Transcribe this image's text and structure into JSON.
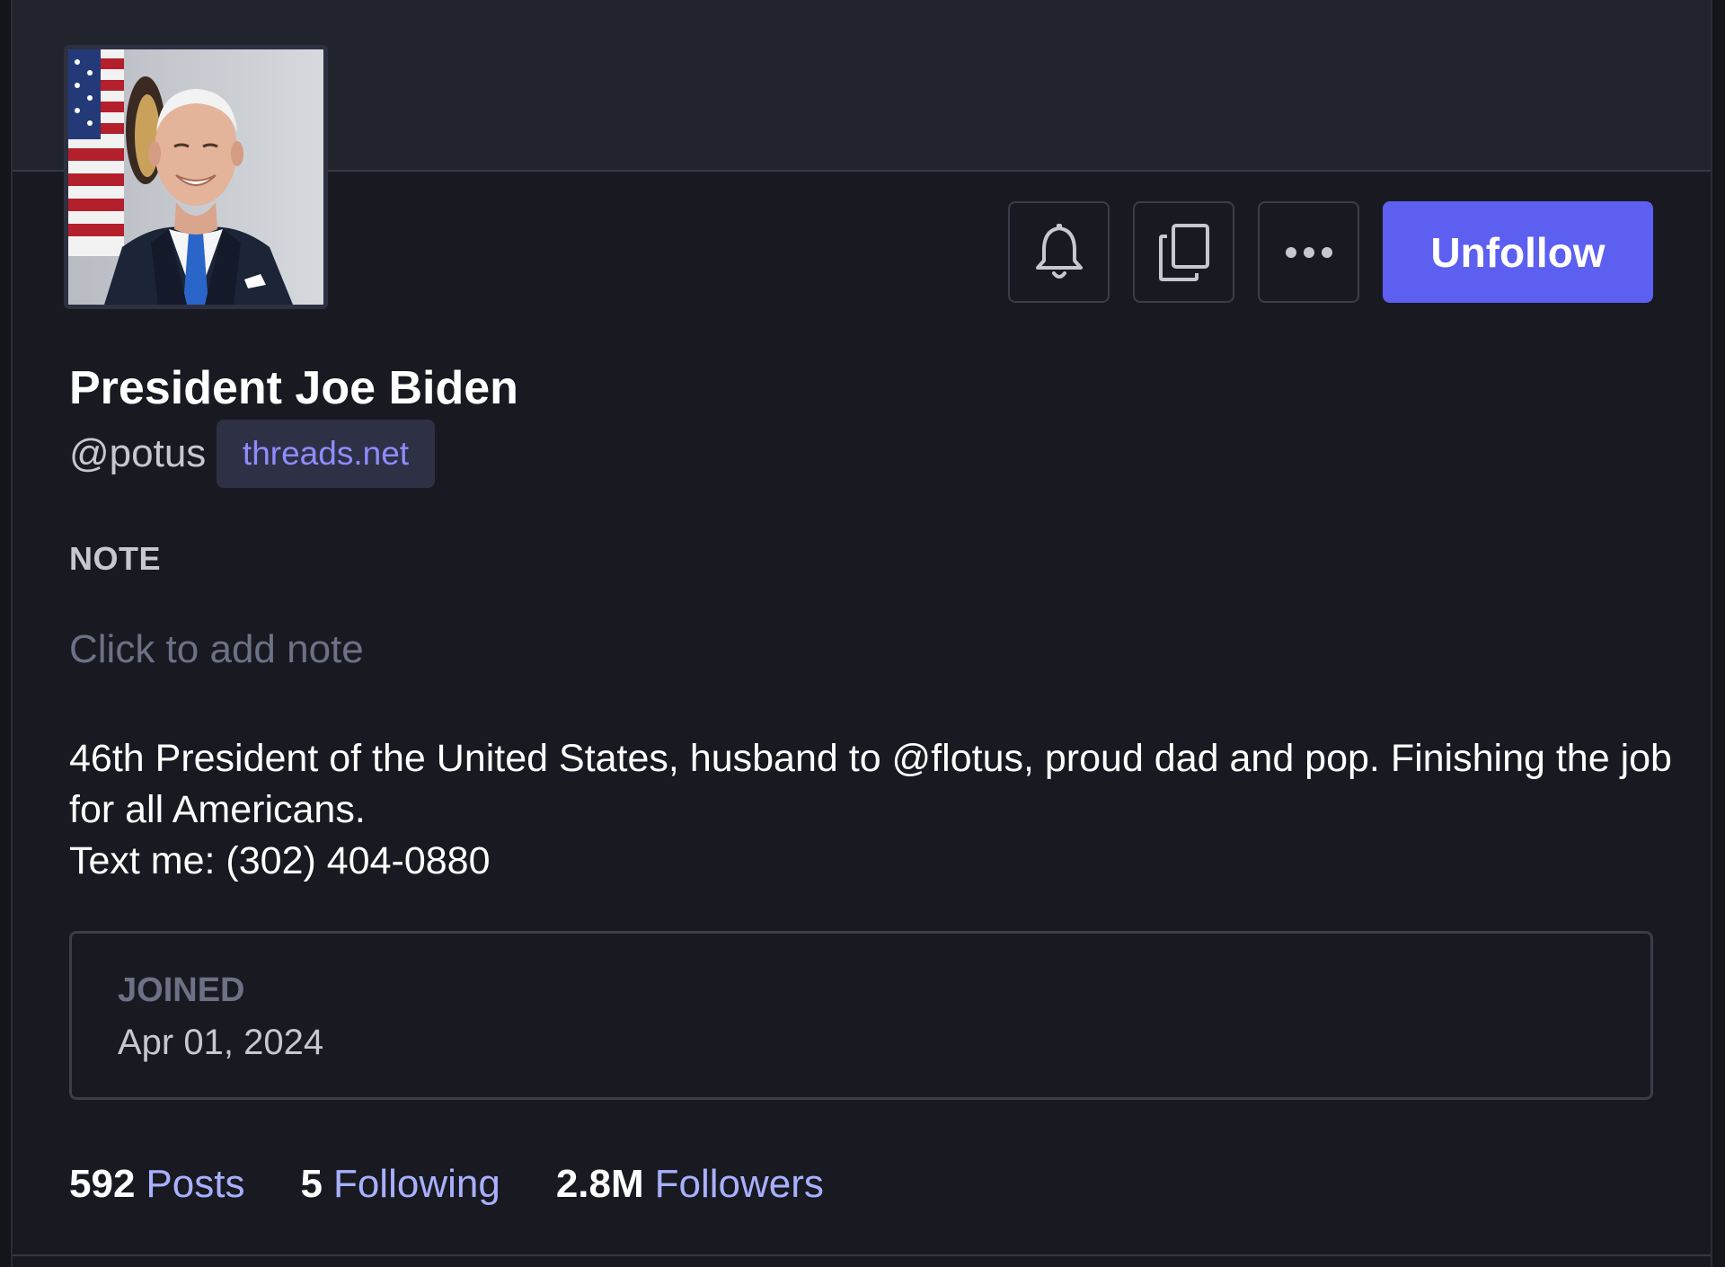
{
  "profile": {
    "display_name": "President Joe Biden",
    "handle": "@potus",
    "domain": "threads.net",
    "avatar_alt": "Portrait of President Joe Biden"
  },
  "actions": {
    "notify_icon": "bell-icon",
    "copy_icon": "copy-icon",
    "more_icon": "more-horizontal-icon",
    "unfollow_label": "Unfollow"
  },
  "note": {
    "label": "NOTE",
    "placeholder": "Click to add note"
  },
  "bio": {
    "line1": "46th President of the United States, husband to @flotus, proud dad and pop. Finishing the job for all Americans.",
    "line2": "Text me: (302) 404-0880"
  },
  "joined": {
    "label": "JOINED",
    "date": "Apr 01, 2024"
  },
  "stats": [
    {
      "value": "592",
      "label": "Posts"
    },
    {
      "value": "5",
      "label": "Following"
    },
    {
      "value": "2.8M",
      "label": "Followers"
    }
  ],
  "colors": {
    "background": "#191a21",
    "banner": "#21232d",
    "accent": "#5c5ff0",
    "link": "#a8b0ff",
    "chip_text": "#8f8cff"
  }
}
